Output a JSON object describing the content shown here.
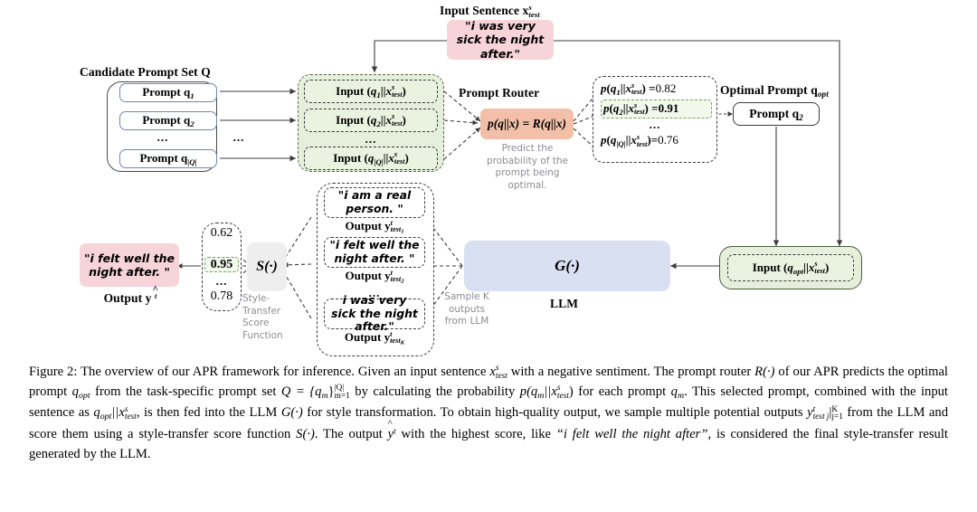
{
  "figure": {
    "headings": {
      "candidate_set": "Candidate Prompt Set Q",
      "input_sentence": "Input Sentence x",
      "input_sentence_sub": "test",
      "input_sentence_sup": "s",
      "prompt_router": "Prompt Router",
      "optimal_prompt": "Optimal Prompt q",
      "optimal_prompt_sub": "opt",
      "llm": "LLM"
    },
    "candidate_prompts": [
      {
        "label": "Prompt q",
        "sub": "1"
      },
      {
        "label": "Prompt q",
        "sub": "2"
      },
      {
        "label": "Prompt q",
        "sub": "|Q|"
      }
    ],
    "ellipsis": "...",
    "input_concat": [
      {
        "label": "Input",
        "q": "q",
        "qsub": "1",
        "x": "x",
        "xsub": "test",
        "xsup": "s"
      },
      {
        "label": "Input",
        "q": "q",
        "qsub": "2",
        "x": "x",
        "xsub": "test",
        "xsup": "s"
      },
      {
        "label": "Input",
        "q": "q",
        "qsub": "|Q|",
        "x": "x",
        "xsub": "test",
        "xsup": "s"
      }
    ],
    "input_sentence_text": "\"i was very sick the night after.\"",
    "router_formula": "p(q||x) = R(q||x)",
    "router_hint": "Predict the probability of the prompt being optimal.",
    "probabilities": [
      {
        "p": "p",
        "q": "q",
        "qsub": "1",
        "x": "x",
        "xsub": "test",
        "xsup": "s",
        "eq": "=",
        "value": "0.82",
        "selected": false
      },
      {
        "p": "p",
        "q": "q",
        "qsub": "2",
        "x": "x",
        "xsub": "test",
        "xsup": "s",
        "eq": "=",
        "value": "0.91",
        "selected": true
      },
      {
        "p": "p",
        "q": "q",
        "qsub": "|Q|",
        "x": "x",
        "xsub": "test",
        "xsup": "s",
        "eq": "=",
        "value": "0.76",
        "selected": false
      }
    ],
    "optimal_prompt_chip": {
      "label": "Prompt q",
      "sub": "2"
    },
    "final_input_chip": {
      "label": "Input",
      "q": "q",
      "qsub": "opt",
      "x": "x",
      "xsub": "test",
      "xsup": "s"
    },
    "llm_symbol": "G(·)",
    "sample_hint": "Sample K outputs from LLM",
    "outputs": [
      {
        "text": "\"i am a real person. \"",
        "label": "Output y",
        "sub": "test",
        "subsub": "1",
        "sup": "t"
      },
      {
        "text": "\"i felt well the night after. \"",
        "label": "Output y",
        "sub": "test",
        "subsub": "2",
        "sup": "t"
      },
      {
        "text": "i was very sick the night after.\"",
        "label": "Output y",
        "sub": "test",
        "subsub": "K",
        "sup": "t"
      }
    ],
    "scores": [
      {
        "value": "0.62",
        "selected": false
      },
      {
        "value": "0.95",
        "selected": true
      },
      {
        "value": "0.78",
        "selected": false
      }
    ],
    "score_function_symbol": "S(·)",
    "score_function_hint": "Style-Transfer Score Function",
    "final_output_text": "\"i felt well the night after. \"",
    "final_output_label": "Output y",
    "final_output_sup": "t"
  },
  "caption": {
    "label": "Figure 2:",
    "line1": "The overview of our APR framework for inference. Given an input sentence",
    "m1": "x",
    "m1sub": "test",
    "m1sup": "s",
    "line2": "with a negative sentiment. The prompt router",
    "m2": "R(·)",
    "line3": "of our APR predicts the optimal prompt",
    "m3": "q",
    "m3sub": "opt",
    "line4": "from the task-specific prompt set",
    "m4": "Q = {q",
    "m4sub": "m",
    "m4close": "}",
    "m4sup": "|Q|",
    "m4sub2": "m=1",
    "line5": "by calculating the probability",
    "m5": "p(q",
    "m5sub": "m",
    "m5bars": "||x",
    "m5xsub": "test",
    "m5xsup": "s",
    "m5close": ")",
    "line6": "for each prompt",
    "m6": "q",
    "m6sub": "m",
    "line7": ". This selected prompt, combined with the input sentence as",
    "m7": "q",
    "m7sub": "opt",
    "m7bars": "||x",
    "m7xsub": "test",
    "m7xsup": "s",
    "line8": ", is then fed into the LLM",
    "m8": "G(·)",
    "line9": "for style transformation. To obtain high-quality output, we sample multiple potential outputs",
    "m9": "y",
    "m9sub": "test j",
    "m9sup": "t",
    "m9bar": "|",
    "m9barsup": "K",
    "m9barsub": "j=1",
    "line10": "from the LLM and score them using a style-transfer score function",
    "m10": "S(·)",
    "line11": ". The output",
    "m11": "y",
    "m11sup": "t",
    "line12": "with the highest score, like",
    "quote": "“i felt well the night after”",
    "line13": ", is considered the final style-transfer result generated by the LLM."
  },
  "colors": {
    "pink": "#f7d4da",
    "green_fill": "#e6efdb",
    "orange": "#f2c0a8",
    "blue": "#d9e0f2",
    "gray_box": "#eeeeee",
    "chip_border_blue": "#7186ad",
    "hint_gray": "#8d8d93",
    "select_green": "#76a15c"
  }
}
